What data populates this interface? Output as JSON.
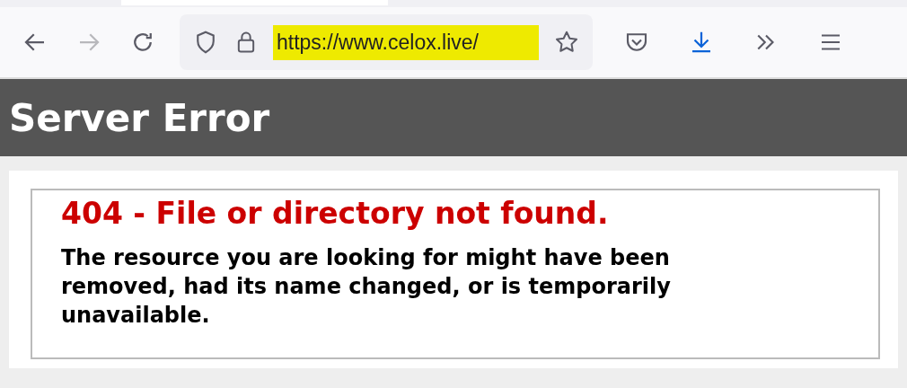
{
  "browser": {
    "back": {
      "disabled": false
    },
    "forward": {
      "disabled": true
    },
    "url": {
      "text": "https://www.celox.live/",
      "highlighted": true
    }
  },
  "header": {
    "title": "Server Error"
  },
  "error": {
    "heading": "404 - File or directory not found.",
    "message": "The resource you are looking for might have been removed, had its name changed, or is temporarily unavailable."
  }
}
